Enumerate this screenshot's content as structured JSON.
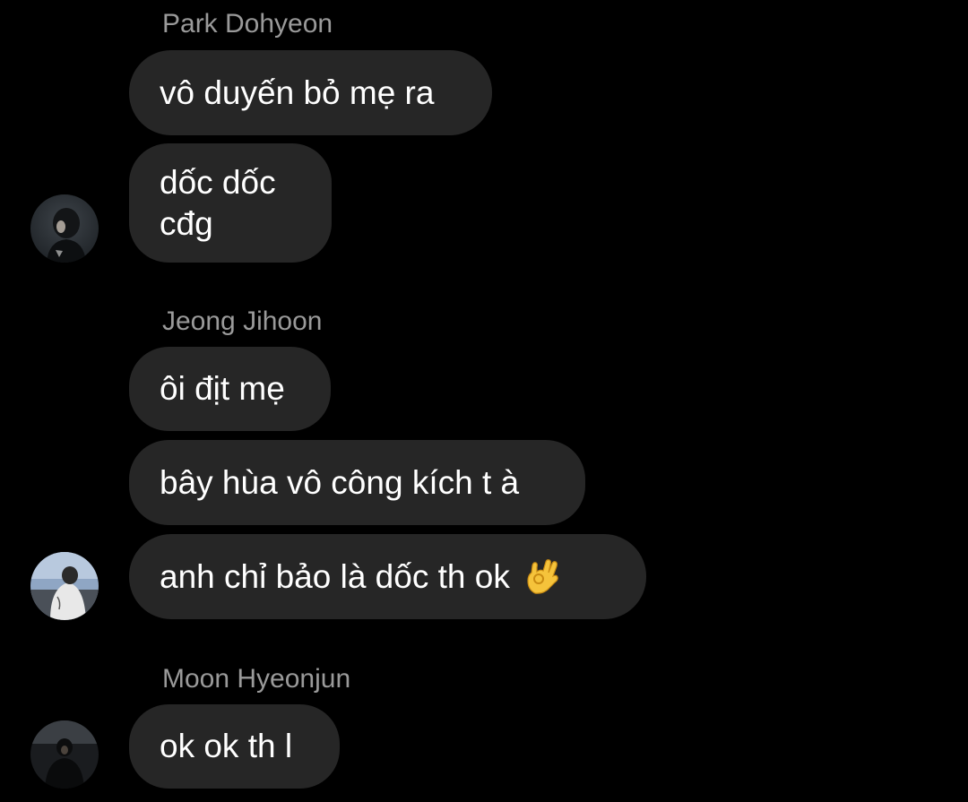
{
  "groups": [
    {
      "sender": "Park Dohyeon",
      "messages": [
        "vô duyến bỏ mẹ ra",
        "dốc dốc",
        "cđg"
      ],
      "avatar_icon": "avatar-park-dohyeon"
    },
    {
      "sender": "Jeong Jihoon",
      "messages": [
        "ôi địt mẹ",
        "bây hùa vô công kích t à",
        "anh chỉ bảo là dốc th ok"
      ],
      "emoji_icon": "ok-hand-emoji",
      "avatar_icon": "avatar-jeong-jihoon"
    },
    {
      "sender": "Moon Hyeonjun",
      "messages": [
        "ok ok th l"
      ],
      "avatar_icon": "avatar-moon-hyeonjun"
    }
  ],
  "colors": {
    "background": "#000000",
    "bubble": "#262626",
    "sender_name": "#9a9a9a",
    "message_text": "#ffffff"
  }
}
